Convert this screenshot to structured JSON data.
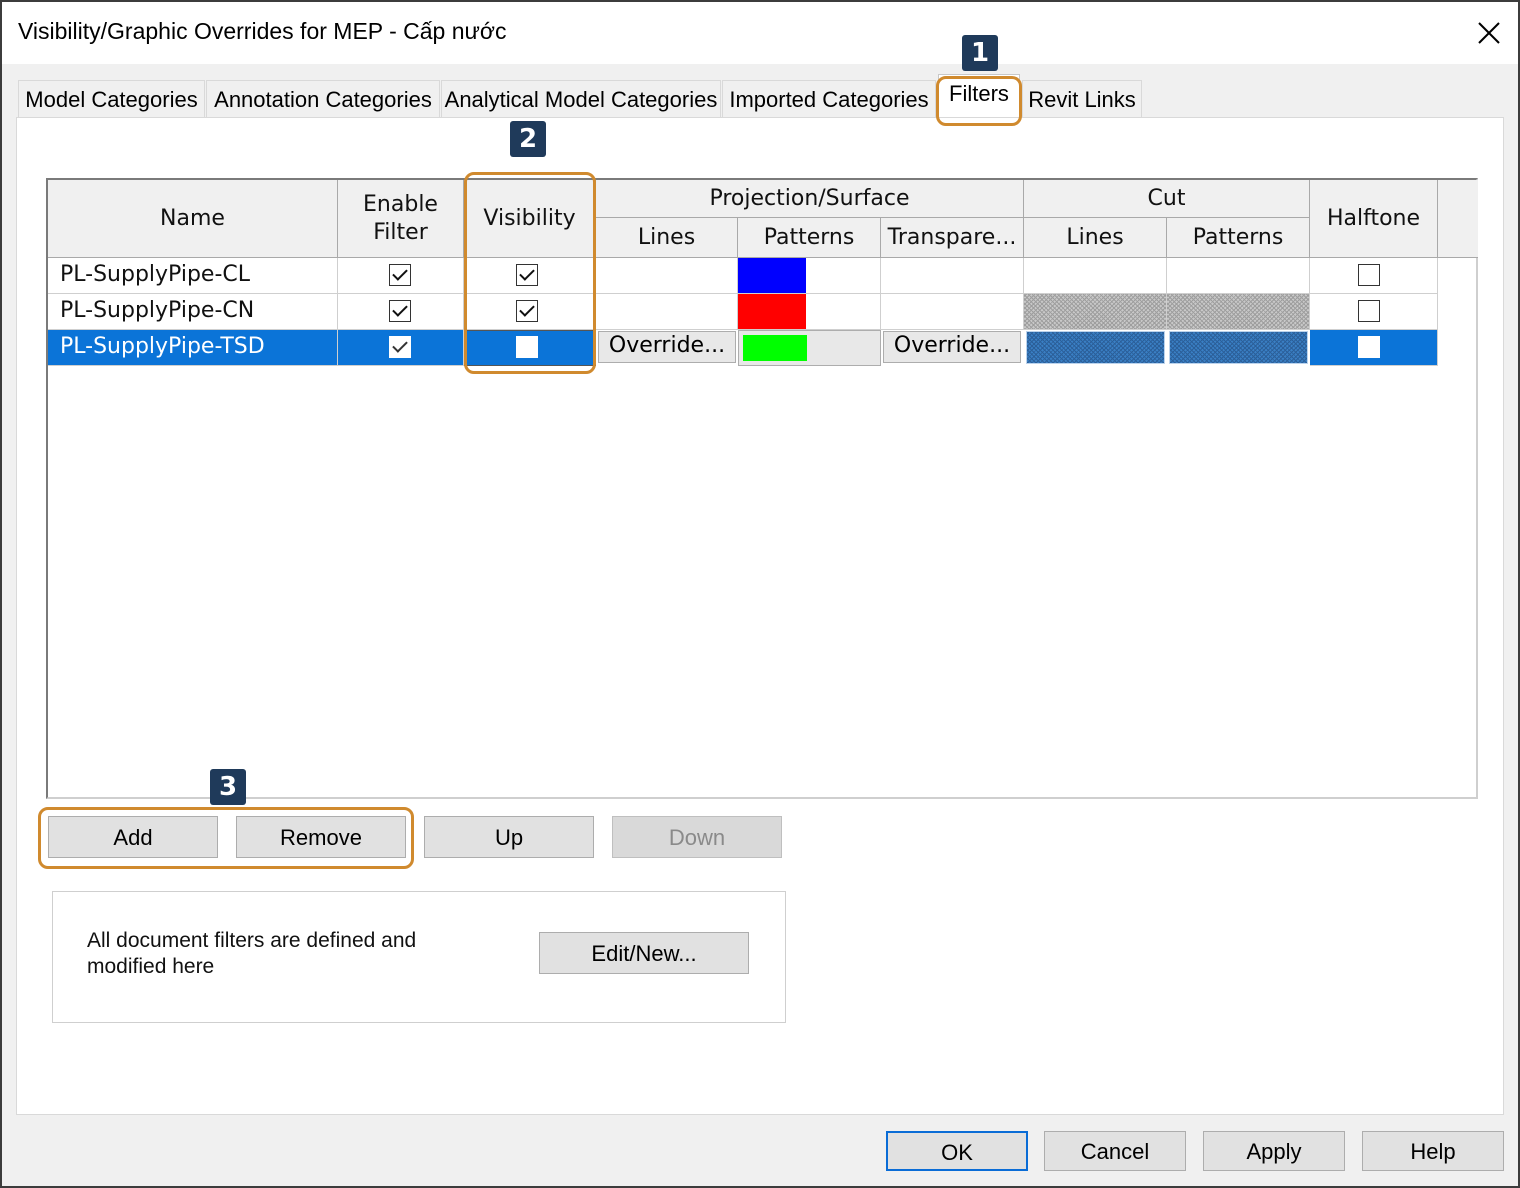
{
  "window": {
    "title": "Visibility/Graphic Overrides for MEP - Cấp nước"
  },
  "tabs": [
    {
      "label": "Model Categories",
      "active": false
    },
    {
      "label": "Annotation Categories",
      "active": false
    },
    {
      "label": "Analytical Model Categories",
      "active": false
    },
    {
      "label": "Imported Categories",
      "active": false
    },
    {
      "label": "Filters",
      "active": true
    },
    {
      "label": "Revit Links",
      "active": false
    }
  ],
  "callouts": [
    "1",
    "2",
    "3"
  ],
  "grid": {
    "headers": {
      "name": "Name",
      "enable_filter": "Enable Filter",
      "visibility": "Visibility",
      "projection_surface": "Projection/Surface",
      "proj_lines": "Lines",
      "proj_patterns": "Patterns",
      "proj_transparency": "Transpare...",
      "cut": "Cut",
      "cut_lines": "Lines",
      "cut_patterns": "Patterns",
      "halftone": "Halftone"
    },
    "rows": [
      {
        "name": "PL-SupplyPipe-CL",
        "enable_filter": true,
        "visibility": true,
        "pattern_color": "#0000ff",
        "halftone": false,
        "selected": false
      },
      {
        "name": "PL-SupplyPipe-CN",
        "enable_filter": true,
        "visibility": true,
        "pattern_color": "#ff0000",
        "halftone": false,
        "selected": false
      },
      {
        "name": "PL-SupplyPipe-TSD",
        "enable_filter": true,
        "visibility": false,
        "pattern_color": "#00ff00",
        "halftone": false,
        "selected": true
      }
    ],
    "override_label": "Override..."
  },
  "list_buttons": {
    "add": "Add",
    "remove": "Remove",
    "up": "Up",
    "down": "Down"
  },
  "info": {
    "text": "All document filters are defined and modified here",
    "edit_new": "Edit/New..."
  },
  "footer": {
    "ok": "OK",
    "cancel": "Cancel",
    "apply": "Apply",
    "help": "Help"
  },
  "colors": {
    "selection": "#0b74d8",
    "callout": "#d08a2e",
    "badge": "#1f3a5a"
  }
}
